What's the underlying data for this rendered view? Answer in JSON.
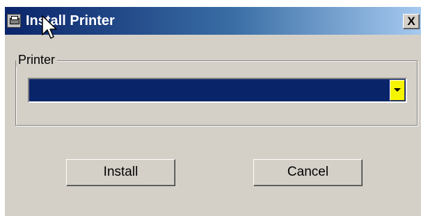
{
  "window": {
    "title": "Install Printer",
    "close_label": "X"
  },
  "printer_group": {
    "label": "Printer",
    "selected_value": ""
  },
  "buttons": {
    "install_label": "Install",
    "cancel_label": "Cancel"
  },
  "colors": {
    "titlebar_start": "#0a246a",
    "titlebar_end": "#a6caf0",
    "dialog_face": "#d4d0c8",
    "selection": "#0a246a",
    "dropdown_button": "#f5f500"
  },
  "icons": {
    "app": "printer-icon",
    "dropdown": "chevron-down-icon",
    "cursor": "mouse-cursor-icon"
  }
}
